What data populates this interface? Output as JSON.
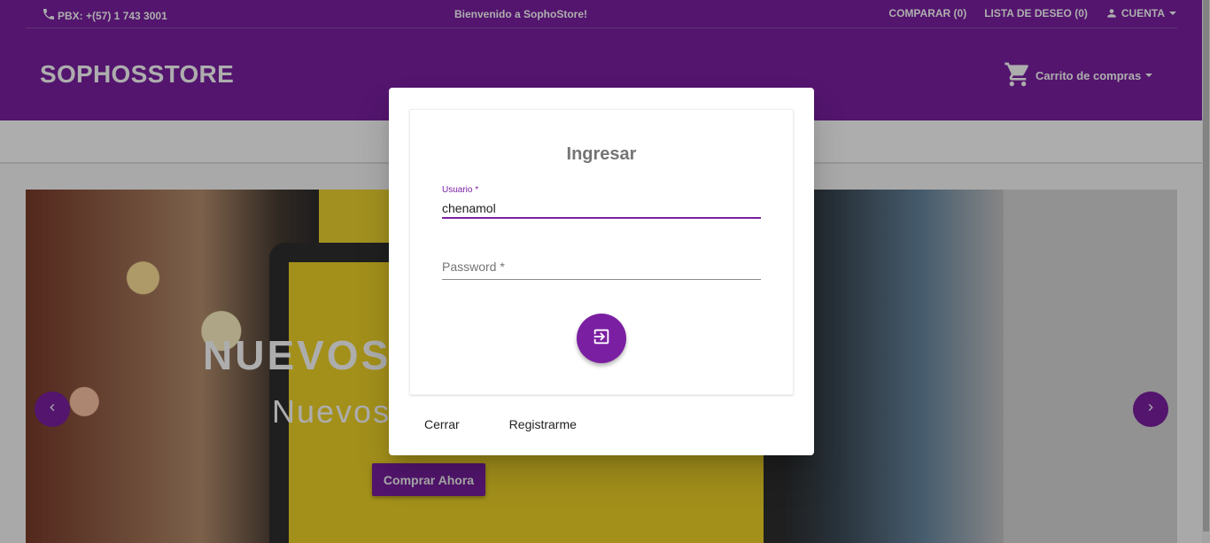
{
  "topbar": {
    "phone": "PBX: +(57) 1 743 3001",
    "welcome": "Bienvenido a SophoStore!",
    "compare": "COMPARAR (0)",
    "wishlist": "LISTA DE DESEO (0)",
    "account": "CUENTA",
    "brand": "SOPHOSSTORE",
    "cart": "Carrito de compras",
    "color": "#7b1fa2"
  },
  "hero": {
    "title": "NUEVOS",
    "subtitle": "Nuevos",
    "buy_button": "Comprar Ahora"
  },
  "modal": {
    "title": "Ingresar",
    "user_label": "Usuario *",
    "user_value": "chenamol",
    "password_placeholder": "Password *",
    "submit_icon": "login-icon",
    "close_label": "Cerrar",
    "register_label": "Registrarme"
  }
}
